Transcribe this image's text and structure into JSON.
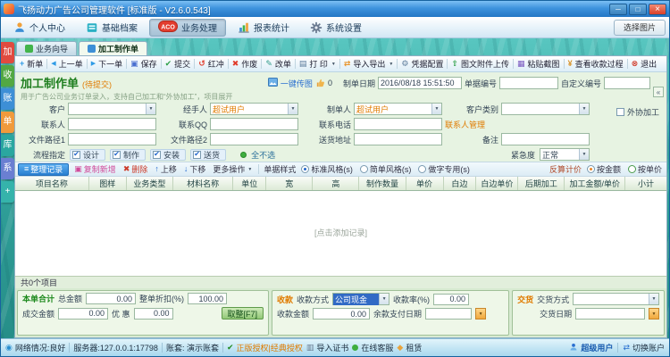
{
  "titlebar": {
    "title": "飞扬动力广告公司管理软件 [标准版 - V2.6.0.543]"
  },
  "menubar": {
    "items": [
      "个人中心",
      "基础档案",
      "业务处理",
      "报表统计",
      "系统设置"
    ],
    "badge": "ACO",
    "select_image": "选择图片"
  },
  "sidebar": {
    "items": [
      {
        "label": "加",
        "color": "#e04a3f"
      },
      {
        "label": "收",
        "color": "#52a843"
      },
      {
        "label": "账",
        "color": "#3d8fd6"
      },
      {
        "label": "单",
        "color": "#f09a3c"
      },
      {
        "label": "库",
        "color": "#2aa7a0"
      },
      {
        "label": "系",
        "color": "#6a7fd2"
      },
      {
        "label": "+",
        "color": "#35b3ab"
      }
    ]
  },
  "doc_tabs": {
    "wizard": "业务向导",
    "work_order": "加工制作单"
  },
  "toolbar": {
    "items": [
      "新单",
      "上一单",
      "下一单",
      "保存",
      "提交",
      "红冲",
      "作废",
      "改单",
      "打 印",
      "导入导出",
      "凭据配置",
      "图文附件上传",
      "粘贴截图",
      "查看收款过程",
      "退出"
    ]
  },
  "form": {
    "title": "加工制作单",
    "status": "(待提交)",
    "subtitle": "用于广告公司业务订单录入，支持自己加工和“外协加工”，项目展开",
    "quick_upload": "一键传图",
    "likes": "0",
    "header_fields": {
      "date_label": "制单日期",
      "date_value": "2016/08/18 15:51:50",
      "order_no_label": "单据编号",
      "order_no_value": "",
      "custom_no_label": "自定义编号",
      "custom_no_value": ""
    },
    "rows": {
      "customer_label": "客户",
      "handler_label": "经手人",
      "handler_value": "超试用户",
      "maker_label": "制单人",
      "maker_value": "超试用户",
      "customer_type_label": "客户类别",
      "contact_label": "联系人",
      "qq_label": "联系QQ",
      "phone_label": "联系电话",
      "contact_manage": "联系人管理",
      "file1_label": "文件路径1",
      "file2_label": "文件路径2",
      "address_label": "送货地址",
      "remark_label": "备注",
      "outsourcing": "外协加工"
    },
    "process": {
      "label": "流程指定",
      "steps": [
        "设计",
        "制作",
        "安装",
        "送货"
      ],
      "select_none": "全不选",
      "urgency_label": "紧急度",
      "urgency_value": "正常"
    }
  },
  "grid": {
    "toolbar": {
      "organize": "整理记录",
      "copy_new": "复制新增",
      "delete": "删除",
      "move_up": "上移",
      "move_down": "下移",
      "more": "更多操作",
      "style_label": "单据样式",
      "style_options": [
        "标准风格(s)",
        "简单风格(s)",
        "做字专用(s)"
      ],
      "calc_label": "反算计价",
      "by_amount": "按金额",
      "by_unit_price": "按单价"
    },
    "columns": [
      "项目名称",
      "图样",
      "业务类型",
      "材料名称",
      "单位",
      "宽",
      "高",
      "制作数量",
      "单价",
      "白边",
      "白边单价",
      "后期加工",
      "加工金额/单价",
      "小计"
    ],
    "empty_hint": "[点击添加记录]",
    "footer_count": "共0个项目"
  },
  "summary": {
    "title": "本单合计",
    "total_label": "总金额",
    "total_value": "0.00",
    "discount_label": "整单折扣(%)",
    "discount_value": "100.00",
    "deal_label": "成交金额",
    "deal_value": "0.00",
    "favor_label": "优 惠",
    "favor_value": "0.00",
    "round_button": "取整[F7]"
  },
  "payment": {
    "title": "收款",
    "method_label": "收款方式",
    "method_value": "公司现金",
    "rate_label": "收款率(%)",
    "rate_value": "0.00",
    "amount_label": "收款金额",
    "amount_value": "0.00",
    "balance_date_label": "余款支付日期",
    "balance_date_value": ""
  },
  "delivery": {
    "title": "交货",
    "method_label": "交货方式",
    "method_value": "",
    "date_label": "交货日期",
    "date_value": ""
  },
  "statusbar": {
    "network": "网络情况:良好",
    "server": "服务器:127.0.0.1:17798",
    "account": "账套: 演示账套",
    "license": "正版授权|经典授权",
    "import_cert": "导入证书",
    "online_service": "在线客服",
    "lease": "租赁",
    "user": "超级用户",
    "switch_user": "切换账户"
  },
  "colors": {
    "accent_green": "#1e8a1e",
    "accent_orange": "#e07b00",
    "title_blue": "#2b7fd0",
    "water_teal": "#35aaa3"
  },
  "icons": {
    "new_order": "+",
    "prev_order": "◀",
    "next_order": "▶",
    "save": "▣",
    "submit": "✔",
    "red_flush": "↺",
    "void": "✖",
    "modify": "✎",
    "print": "▤",
    "import_export": "⇄",
    "voucher_config": "⚙",
    "attach_upload": "⇧",
    "paste_shot": "▦",
    "payment_view": "¥",
    "exit": "⊗",
    "organize": "≡",
    "copy_new": "▣",
    "delete": "✖",
    "up": "↑",
    "down": "↓",
    "network": "◉",
    "check": "✔",
    "cert": "▥",
    "service": "●",
    "lease": "◆",
    "switch": "⇄"
  }
}
